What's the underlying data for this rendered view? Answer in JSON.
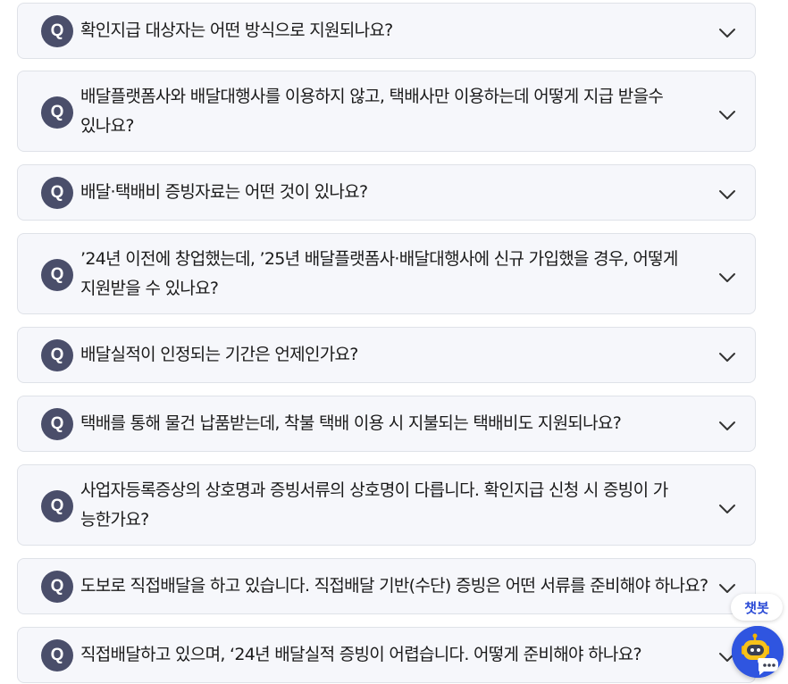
{
  "faq": {
    "badge": "Q",
    "items": [
      {
        "question": "확인지급 대상자는 어떤 방식으로 지원되나요?"
      },
      {
        "question": "배달플랫폼사와 배달대행사를 이용하지 않고, 택배사만 이용하는데 어떻게 지급 받을수 있나요?"
      },
      {
        "question": "배달·택배비 증빙자료는 어떤 것이 있나요?"
      },
      {
        "question": "’24년 이전에 창업했는데, ’25년 배달플랫폼사·배달대행사에 신규 가입했을 경우, 어떻게 지원받을 수 있나요?"
      },
      {
        "question": "배달실적이 인정되는 기간은 언제인가요?"
      },
      {
        "question": "택배를 통해 물건 납품받는데, 착불 택배 이용 시 지불되는 택배비도 지원되나요?"
      },
      {
        "question": "사업자등록증상의 상호명과 증빙서류의 상호명이 다릅니다. 확인지급 신청 시 증빙이 가능한가요?"
      },
      {
        "question": "도보로 직접배달을 하고 있습니다. 직접배달 기반(수단) 증빙은 어떤 서류를 준비해야 하나요?"
      },
      {
        "question": "직접배달하고 있으며, ‘24년 배달실적 증빙이 어렵습니다. 어떻게 준비해야 하나요?"
      }
    ]
  },
  "chatbot": {
    "label": "챗봇",
    "icon": "robot-chat-icon",
    "accent": "#2f55e0"
  },
  "colors": {
    "card_bg": "#f6f7fb",
    "card_border": "#dfe2e8",
    "badge_bg": "#4a4e6a"
  }
}
